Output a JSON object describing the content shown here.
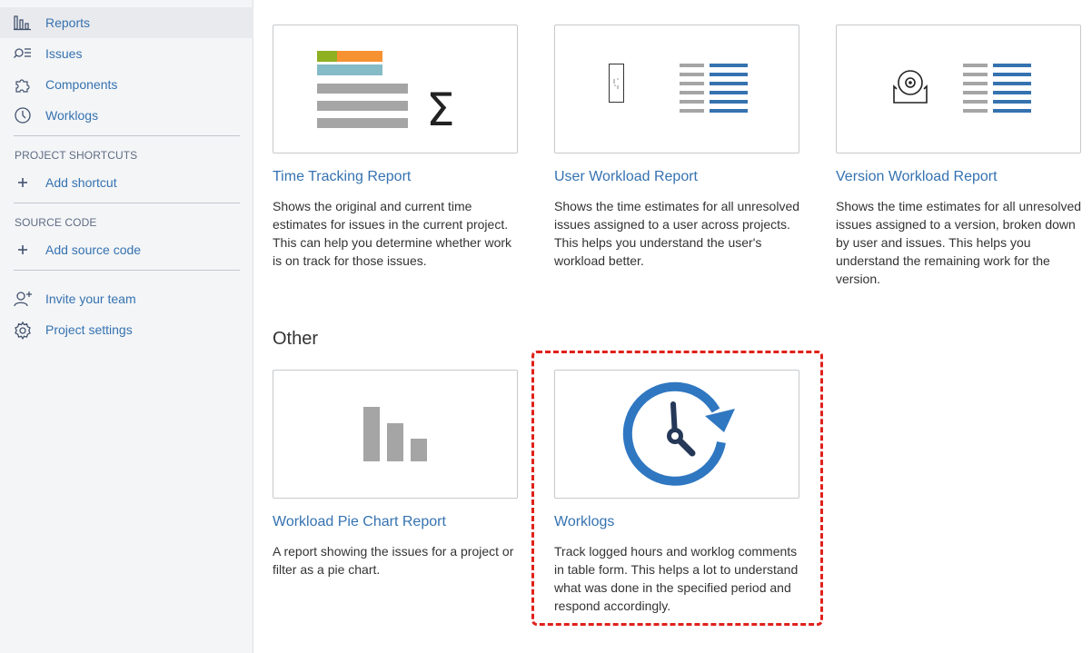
{
  "sidebar": {
    "nav": [
      {
        "label": "Reports",
        "icon": "reports-icon"
      },
      {
        "label": "Issues",
        "icon": "issues-icon"
      },
      {
        "label": "Components",
        "icon": "components-icon"
      },
      {
        "label": "Worklogs",
        "icon": "clock-icon"
      }
    ],
    "project_shortcuts_title": "PROJECT SHORTCUTS",
    "add_shortcut": "Add shortcut",
    "source_code_title": "SOURCE CODE",
    "add_source_code": "Add source code",
    "invite_team": "Invite your team",
    "project_settings": "Project settings"
  },
  "reports": {
    "cards": [
      {
        "title": "Time Tracking Report",
        "desc": "Shows the original and current time estimates for issues in the current project. This can help you determine whether work is on track for those issues."
      },
      {
        "title": "User Workload Report",
        "desc": "Shows the time estimates for all unresolved issues assigned to a user across projects. This helps you understand the user's workload better."
      },
      {
        "title": "Version Workload Report",
        "desc": "Shows the time estimates for all unresolved issues assigned to a version, broken down by user and issues. This helps you understand the remaining work for the version."
      }
    ],
    "other_heading": "Other",
    "other_cards": [
      {
        "title": "Workload Pie Chart Report",
        "desc": "A report showing the issues for a project or filter as a pie chart."
      },
      {
        "title": "Worklogs",
        "desc": "Track logged hours and worklog comments in table form. This helps a lot to understand what was done in the specified period and respond accordingly."
      }
    ]
  },
  "colors": {
    "link": "#3572b0",
    "highlight": "#e0201b",
    "worklog_blue": "#2f77c1",
    "clock_dark": "#253858"
  }
}
